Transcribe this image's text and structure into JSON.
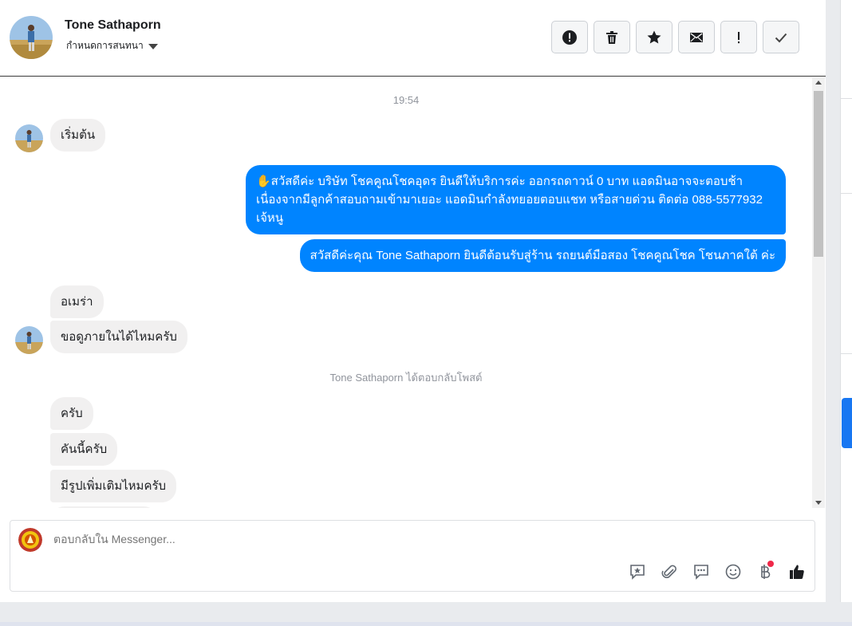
{
  "header": {
    "name": "Tone Sathaporn",
    "subtitle": "กำหนดการสนทนา"
  },
  "actions": [
    {
      "icon": "alert-circle-icon"
    },
    {
      "icon": "trash-icon"
    },
    {
      "icon": "star-icon"
    },
    {
      "icon": "envelope-icon"
    },
    {
      "icon": "exclamation-icon"
    },
    {
      "icon": "check-icon"
    }
  ],
  "conversation": {
    "timestamp": "19:54",
    "messages": [
      {
        "dir": "in",
        "text": "เริ่มต้น"
      },
      {
        "dir": "out",
        "text": "✋สวัสดีค่ะ บริษัท โชคคูณโชคอุดร ยินดีให้บริการค่ะ ออกรถดาวน์ 0 บาท แอดมินอาจจะตอบช้าเนื่องจากมีลูกค้าสอบถามเข้ามาเยอะ แอดมินกำลังทยอยตอบแชท หรือสายด่วน ติดต่อ 088-5577932 เจ้หนู"
      },
      {
        "dir": "out",
        "text": "สวัสดีค่ะคุณ Tone Sathaporn ยินดีต้อนรับสู่ร้าน รถยนต์มือสอง โชคคูณโชค โชนภาคใต้ ค่ะ"
      },
      {
        "dir": "in",
        "text": "อเมร่า"
      },
      {
        "dir": "in",
        "text": "ขอดูภายในได้ไหมครับ"
      },
      {
        "dir": "in",
        "text": "ครับ"
      },
      {
        "dir": "in",
        "text": "คันนี้ครับ"
      },
      {
        "dir": "in",
        "text": "มีรูปเพิ่มเติมไหมครับ"
      }
    ],
    "event": "Tone Sathaporn ได้ตอบกลับโพสต์"
  },
  "composer": {
    "placeholder": "ตอบกลับใน Messenger..."
  },
  "tools": [
    {
      "icon": "saved-reply-icon"
    },
    {
      "icon": "attachment-icon"
    },
    {
      "icon": "chat-bubble-icon"
    },
    {
      "icon": "emoji-icon"
    },
    {
      "icon": "baht-payment-icon",
      "badge": true
    },
    {
      "icon": "thumbs-up-icon"
    }
  ],
  "colors": {
    "outgoing": "#0084ff",
    "incoming": "#f1f0f0",
    "accent": "#1877f2"
  }
}
